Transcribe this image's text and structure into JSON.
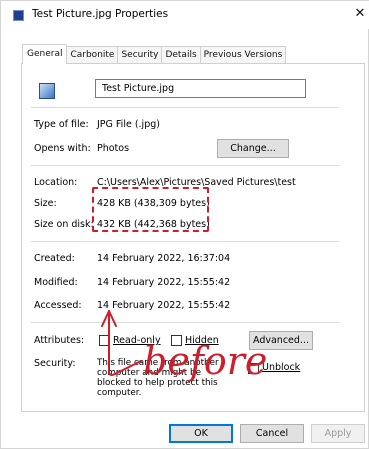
{
  "window": {
    "title": "Test Picture.jpg Properties",
    "close_glyph": "✕"
  },
  "tabs": [
    "General",
    "Carbonite",
    "Security",
    "Details",
    "Previous Versions"
  ],
  "file": {
    "name": "Test Picture.jpg",
    "icon": "image-file-icon"
  },
  "general": {
    "type_label": "Type of file:",
    "type_value": "JPG File (.jpg)",
    "opens_label": "Opens with:",
    "opens_value": "Photos",
    "change_button": "Change...",
    "location_label": "Location:",
    "location_value": "C:\\Users\\Alex\\Pictures\\Saved Pictures\\test",
    "size_label": "Size:",
    "size_value": "428 KB (438,309 bytes)",
    "size_on_disk_label": "Size on disk:",
    "size_on_disk_value": "432 KB (442,368 bytes)",
    "created_label": "Created:",
    "created_value": "14 February 2022, 16:37:04",
    "modified_label": "Modified:",
    "modified_value": "14 February 2022, 15:55:42",
    "accessed_label": "Accessed:",
    "accessed_value": "14 February 2022, 15:55:42",
    "attributes_label": "Attributes:",
    "readonly_label": "Read-only",
    "hidden_label": "Hidden",
    "advanced_button": "Advanced...",
    "security_label": "Security:",
    "security_text": "This file came from another computer and might be blocked to help protect this computer.",
    "unblock_label": "Unblock"
  },
  "footer": {
    "ok": "OK",
    "cancel": "Cancel",
    "apply": "Apply"
  },
  "annotation": {
    "text": "before",
    "color": "#cc1f2b"
  }
}
